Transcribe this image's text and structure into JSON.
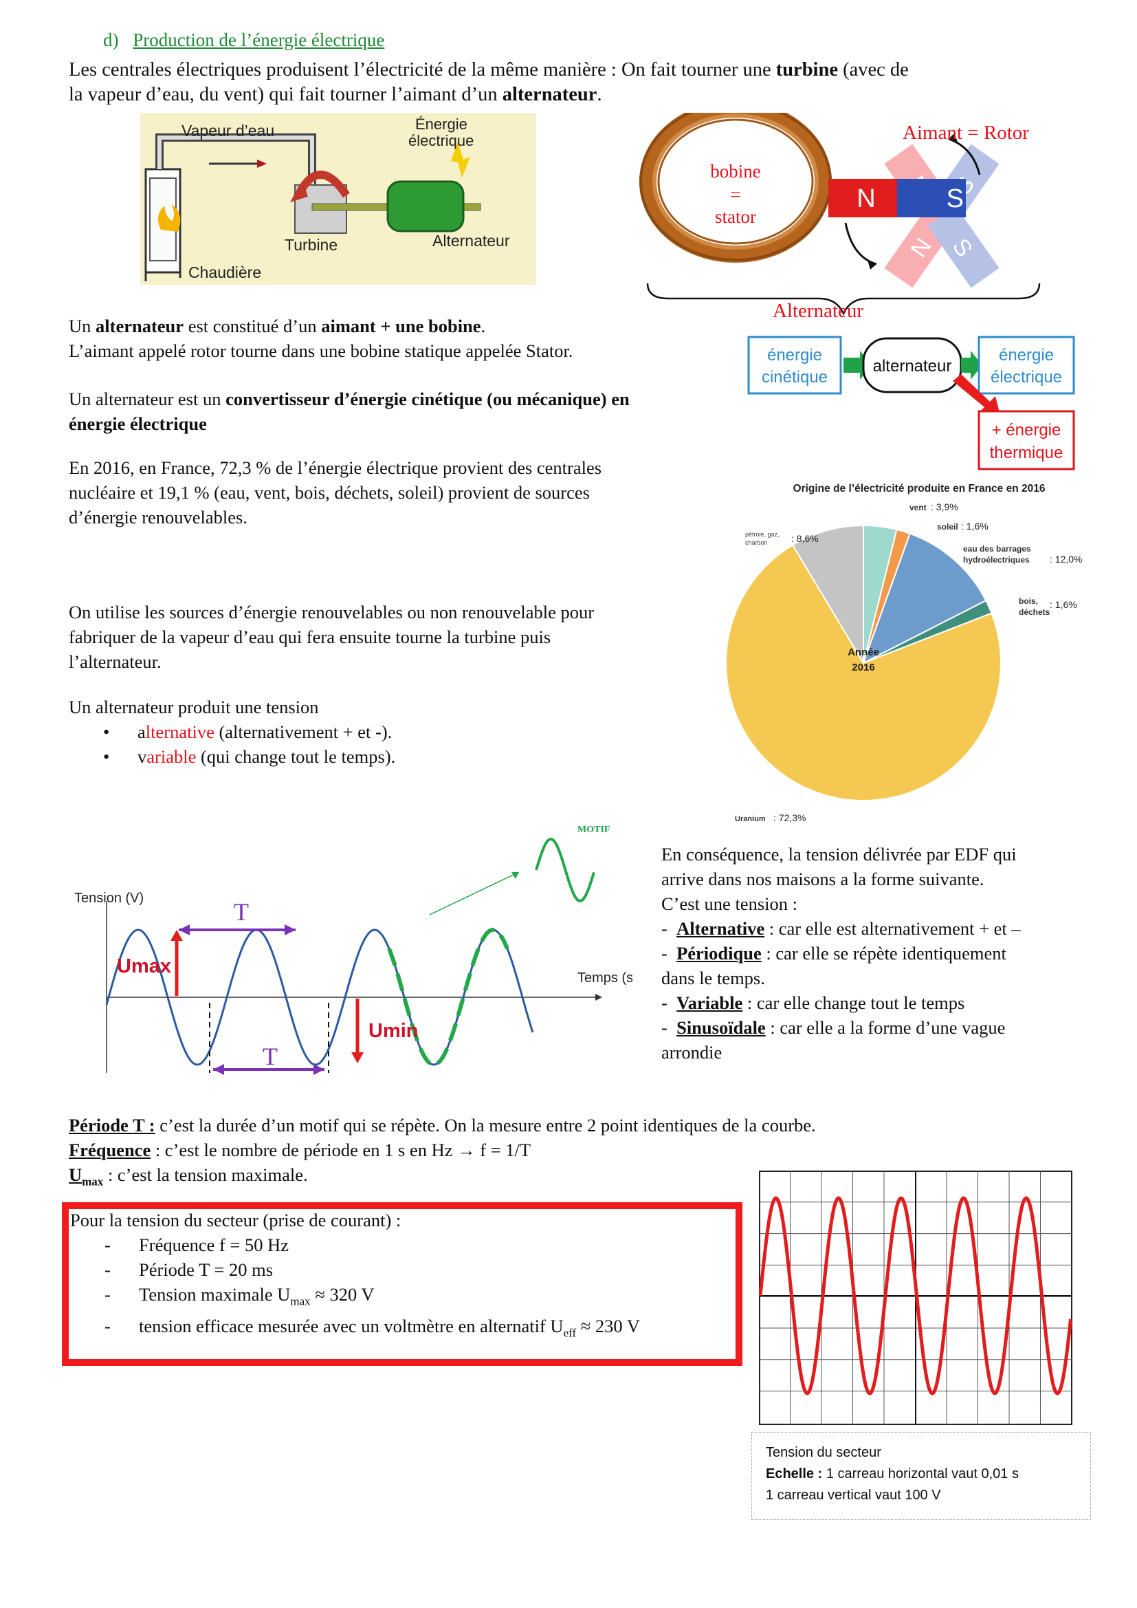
{
  "section": {
    "letter": "d)",
    "title": "Production de l’énergie électrique"
  },
  "intro": {
    "p1_a": "Les centrales électriques produisent l’électricité de la même manière : On fait tourner une ",
    "p1_b": "turbine",
    "p1_c": " (avec de",
    "p2_a": "la vapeur d’eau, du vent) qui fait tourner l’aimant d’un ",
    "p2_b": "alternateur",
    "p2_c": "."
  },
  "plant_figure": {
    "vapeur": "Vapeur d’eau",
    "energie1": "Énergie",
    "energie2": "électrique",
    "turbine": "Turbine",
    "alternateur": "Alternateur",
    "chaudiere": "Chaudière"
  },
  "alternator_figure": {
    "aimant_rotor": "Aimant = Rotor",
    "bobine": "bobine",
    "equals": "=",
    "stator": "stator",
    "N": "N",
    "S": "S",
    "alternateur": "Alternateur"
  },
  "definition": {
    "l1_a": "Un ",
    "l1_b": "alternateur",
    "l1_c": " est constitué d’un ",
    "l1_d": "aimant + une bobine",
    "l1_e": ".",
    "l2": "L’aimant appelé rotor tourne dans une bobine statique appelée Stator.",
    "l3_a": "Un alternateur est un ",
    "l3_b": "convertisseur d’énergie cinétique (ou mécanique) en",
    "l4_b": "énergie électrique"
  },
  "energy_chain": {
    "box1_l1": "énergie",
    "box1_l2": "cinétique",
    "center": "alternateur",
    "box2_l1": "énergie",
    "box2_l2": "électrique",
    "box3_l1": "+ énergie",
    "box3_l2": "thermique"
  },
  "stats": {
    "l1": "En 2016, en France, 72,3 % de l’énergie électrique provient des centrales",
    "l2": "nucléaire et 19,1 % (eau, vent, bois, déchets, soleil) provient de sources",
    "l3": "d’énergie renouvelables."
  },
  "chart_data": {
    "type": "pie",
    "title": "Origine de l’électricité produite en France en 2016",
    "center_label_1": "Année",
    "center_label_2": "2016",
    "slices": [
      {
        "label": "vent",
        "value": 3.9,
        "value_label": ": 3,9%",
        "color": "#9fd8cc"
      },
      {
        "label": "soleil",
        "value": 1.6,
        "value_label": ": 1,6%",
        "color": "#f39a4a"
      },
      {
        "label_1": "eau des barrages",
        "label_2": "hydroélectriques",
        "value": 12.0,
        "value_label": ": 12,0%",
        "color": "#6c9bcc"
      },
      {
        "label_1": "bois,",
        "label_2": "déchets",
        "value": 1.6,
        "value_label": ": 1,6%",
        "color": "#3f8f7d"
      },
      {
        "label": "Uranium",
        "value": 72.3,
        "value_label": ": 72,3%",
        "color": "#f5c851"
      },
      {
        "label_1": "pétrole, gaz,",
        "label_2": "charbon",
        "value": 8.6,
        "value_label": ": 8,6%",
        "color": "#c4c4c4"
      }
    ]
  },
  "usage": {
    "l1": "On utilise les sources d’énergie renouvelables ou non renouvelable pour",
    "l2": "fabriquer de la vapeur d’eau qui fera ensuite tourne la turbine puis",
    "l3": "l’alternateur."
  },
  "alt_tension": {
    "intro": "Un alternateur produit une tension",
    "b1_a": "a",
    "b1_b": "lternative",
    "b1_c": " (alternativement + et -).",
    "b2_a": "v",
    "b2_b": "ariable",
    "b2_c": " (qui change tout le temps).",
    "bullet": "•"
  },
  "wave_figure": {
    "motif": "MOTIF",
    "tension": "Tension (V)",
    "temps": "Temps (s)",
    "T": "T",
    "umax": "Umax",
    "umin": "Umin"
  },
  "consequence": {
    "l1": "En conséquence, la tension délivrée par EDF qui",
    "l2": "arrive dans nos maisons a la forme suivante.",
    "l3": "C’est une tension :",
    "dash": "-",
    "i1_term": "Alternative",
    "i1_rest": " : car elle est alternativement + et –",
    "i2_term": "Périodique",
    "i2_rest": " : car elle se répète identiquement",
    "i2_cont": "dans le temps.",
    "i3_term": "Variable",
    "i3_rest": " : car elle change tout le temps",
    "i4_term": "Sinusoïdale",
    "i4_rest": " : car elle a la forme d’une vague",
    "i4_cont": "arrondie"
  },
  "definitions2": {
    "periode_term": "Période T :",
    "periode_rest": " c’est la durée d’un motif qui se répète. On la mesure entre 2 point identiques de la courbe.",
    "freq_term": "Fréquence",
    "freq_rest": " : c’est le nombre de période en 1 s  en Hz ",
    "freq_arrow": "→",
    "freq_formula": " f = 1/T",
    "umax_term": "U",
    "umax_sub": "max",
    "umax_rest": " : c’est la tension maximale."
  },
  "secteur_box": {
    "title": "Pour la tension du secteur (prise de courant) :",
    "i1": "Fréquence f = 50 Hz",
    "i2": "Période T = 20 ms",
    "i3_a": "Tension maximale U",
    "i3_sub": "max",
    "i3_b": " ≈ 320 V",
    "i4_a": "tension efficace mesurée avec un voltmètre en alternatif U",
    "i4_sub": "eff",
    "i4_b": "  ≈ 230 V"
  },
  "oscillo_caption": {
    "l1": "Tension du secteur",
    "l2_b": "Echelle :",
    "l2_rest": " 1 carreau horizontal vaut 0,01 s",
    "l3": "1 carreau vertical vaut 100 V"
  },
  "colors": {
    "accent_red": "#e2141c",
    "link_green": "#1e8a35",
    "purple": "#7b33b5",
    "chain_blue": "#2f8ccc",
    "wave_blue": "#2c5aa0",
    "dash_green": "#22a84a"
  }
}
